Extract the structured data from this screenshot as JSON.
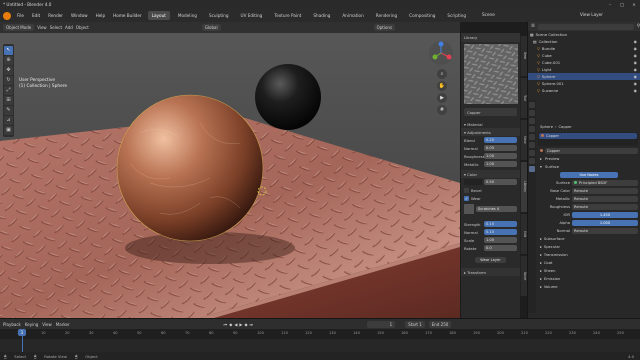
{
  "window": {
    "title": "* Untitled - Blender 4.0"
  },
  "menu": {
    "items": [
      "File",
      "Edit",
      "Render",
      "Window",
      "Help",
      "Home Builder"
    ],
    "workspaces": [
      "Layout",
      "Modeling",
      "Sculpting",
      "UV Editing",
      "Texture Paint",
      "Shading",
      "Animation",
      "Rendering",
      "Compositing",
      "Scripting"
    ],
    "active_workspace": "Layout",
    "scene": "Scene",
    "view_layer": "View Layer"
  },
  "viewport": {
    "mode": "Object Mode",
    "menus": [
      "View",
      "Select",
      "Add",
      "Object"
    ],
    "orientation": "Global",
    "options": "Options",
    "view_name": "User Perspective",
    "collection_label": "(1) Collection | Sphere"
  },
  "node_panel": {
    "library_label": "Library",
    "material_name": "Copper",
    "section_material": "Material",
    "section_adjustments": "Adjustments",
    "blend_label": "Blend",
    "blend_value": "0.20",
    "normal_label": "Normal",
    "normal_value": "0.05",
    "roughness_label": "Roughness",
    "roughness_value": "1.00",
    "metallic_label": "Metallic",
    "metallic_value": "1.00",
    "section_color": "Color",
    "color_value": "0.50",
    "bevel_label": "Bevel",
    "wear_label": "Wear",
    "scratches_label": "Scratches 4",
    "strength_label": "Strength",
    "strength_value": "0.10",
    "normal2_label": "Normal",
    "normal2_value": "0.10",
    "scale_label": "Scale",
    "scale_value": "1.00",
    "rotate_label": "Rotate",
    "rotate_value": "0.0",
    "wear_layer_button": "Wear Layer",
    "section_transform": "Transform"
  },
  "outliner": {
    "title": "Scene Collection",
    "items": [
      {
        "name": "Collection",
        "selected": false
      },
      {
        "name": "Bundle",
        "selected": false
      },
      {
        "name": "Cube",
        "selected": false
      },
      {
        "name": "Cube.001",
        "selected": false
      },
      {
        "name": "Light",
        "selected": false
      },
      {
        "name": "Sphere",
        "selected": true
      },
      {
        "name": "Sphere.001",
        "selected": false
      },
      {
        "name": "Suzanne",
        "selected": false
      }
    ]
  },
  "properties": {
    "object_name": "Sphere",
    "material_name": "Copper",
    "slot_name": "Copper",
    "section_preview": "Preview",
    "section_surface": "Surface",
    "use_nodes": "Use Nodes",
    "surface_label": "Surface",
    "surface_value": "Principled BSDF",
    "rows": [
      {
        "label": "Base Color",
        "value": "Reroute"
      },
      {
        "label": "Metallic",
        "value": "Reroute"
      },
      {
        "label": "Roughness",
        "value": "Reroute"
      },
      {
        "label": "IOR",
        "value": "1.450"
      },
      {
        "label": "Alpha",
        "value": "1.000"
      },
      {
        "label": "Normal",
        "value": "Reroute"
      }
    ],
    "collapsed": [
      "Subsurface",
      "Specular",
      "Transmission",
      "Coat",
      "Sheen",
      "Emission",
      "Volume"
    ]
  },
  "timeline": {
    "menus": [
      "Playback",
      "Keying",
      "View",
      "Marker"
    ],
    "current_frame": "1",
    "start_label": "Start",
    "start_value": "1",
    "end_label": "End",
    "end_value": "250",
    "ticks": [
      "1",
      "10",
      "20",
      "30",
      "40",
      "50",
      "60",
      "70",
      "80",
      "90",
      "100",
      "110",
      "120",
      "130",
      "140",
      "150",
      "160",
      "170",
      "180",
      "190",
      "200",
      "210",
      "220",
      "230",
      "240",
      "250"
    ]
  },
  "status": {
    "left": "Select",
    "middle": "Rotate View",
    "right": "Object",
    "version": "4.0"
  }
}
